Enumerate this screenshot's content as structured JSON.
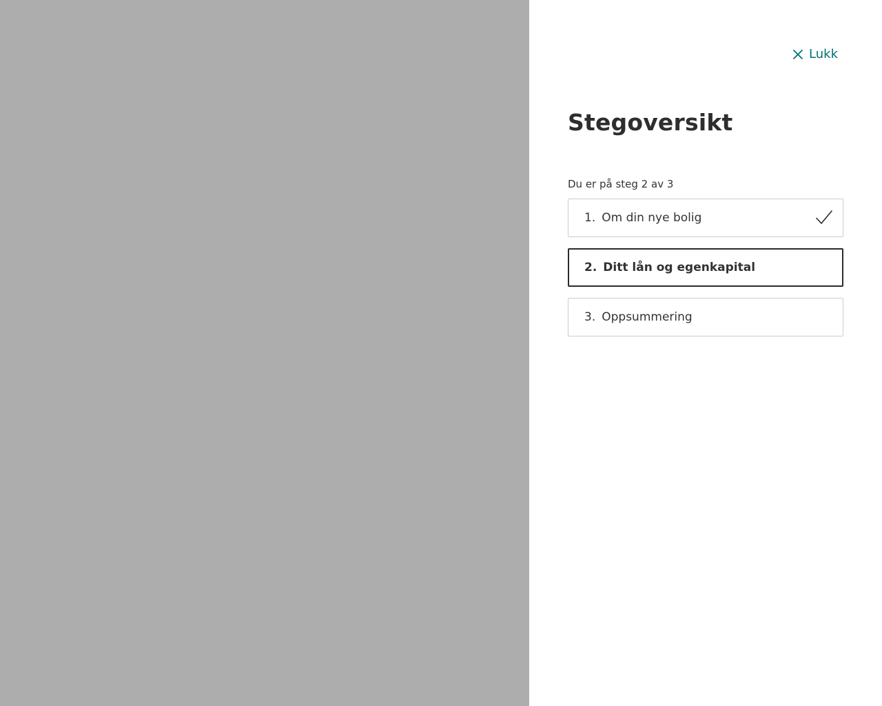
{
  "drawer": {
    "close_label": "Lukk",
    "title": "Stegoversikt",
    "progress_text": "Du er på steg 2 av 3",
    "steps": [
      {
        "number": "1.",
        "label": "Om din nye bolig",
        "status": "completed",
        "icon": "checkmark-icon"
      },
      {
        "number": "2.",
        "label": "Ditt lån og egenkapital",
        "status": "current"
      },
      {
        "number": "3.",
        "label": "Oppsummering",
        "status": "upcoming"
      }
    ]
  },
  "colors": {
    "overlay": "#adadad",
    "accent": "#007272",
    "active_border": "#2b2b2b",
    "step_border": "#cccccc"
  }
}
